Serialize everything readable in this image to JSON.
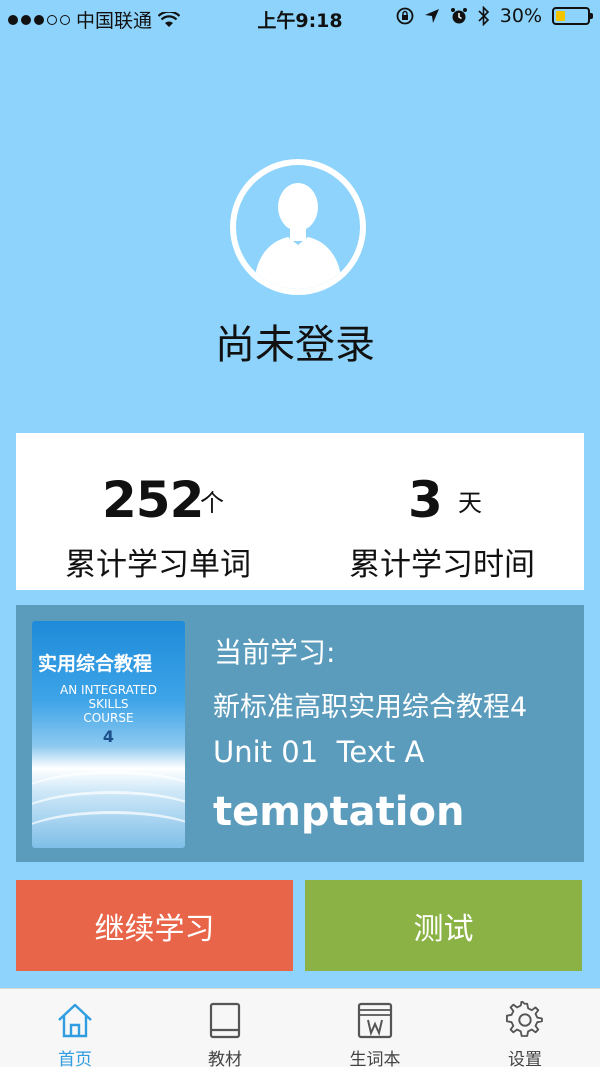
{
  "status_bar": {
    "carrier": "中国联通",
    "time": "上午9:18",
    "battery_percent": "30%",
    "battery_level": 0.3,
    "signal_bars_filled": 3,
    "signal_bars_total": 5
  },
  "profile": {
    "avatar_icon": "user-avatar-icon",
    "login_status": "尚未登录"
  },
  "stats": {
    "words_count": "252",
    "words_unit": "个",
    "words_label": "累计学习单词",
    "days_count": "3",
    "days_unit": "天",
    "days_label": "累计学习时间"
  },
  "current_study": {
    "label": "当前学习:",
    "book_name": "新标准高职实用综合教程4",
    "unit": "Unit 01  Text A",
    "word": "temptation",
    "cover": {
      "title": "实用综合教程",
      "en_line1": "AN INTEGRATED",
      "en_line2": "SKILLS",
      "en_line3": "COURSE",
      "number": "4"
    }
  },
  "actions": {
    "continue_label": "继续学习",
    "test_label": "测试"
  },
  "tab_bar": {
    "tabs": [
      {
        "label": "首页",
        "icon": "home-icon",
        "active": true
      },
      {
        "label": "教材",
        "icon": "book-icon",
        "active": false
      },
      {
        "label": "生词本",
        "icon": "vocabulary-icon",
        "active": false
      },
      {
        "label": "设置",
        "icon": "gear-icon",
        "active": false
      }
    ]
  },
  "colors": {
    "background": "#8dd3fb",
    "study_card": "#5b9cbd",
    "continue_button": "#e8654a",
    "test_button": "#8bb244",
    "active_tab": "#2f9de0"
  }
}
